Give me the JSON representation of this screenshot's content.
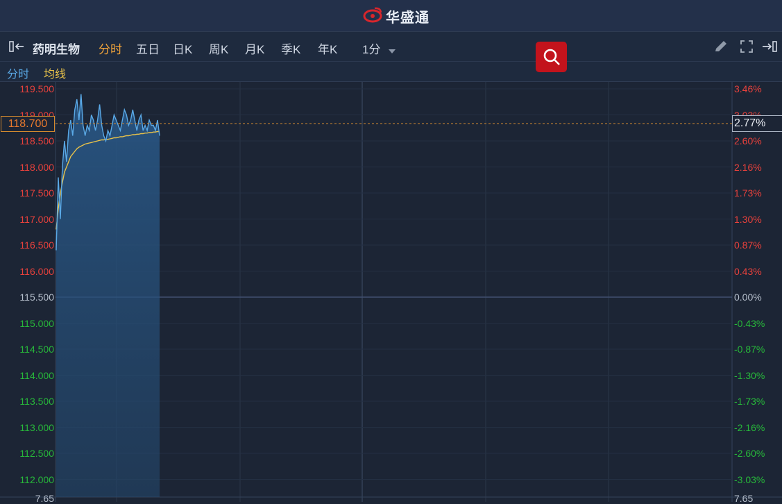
{
  "app": {
    "brand_name": "华盛通"
  },
  "toolbar": {
    "stock_name": "药明生物",
    "tabs": [
      "分时",
      "五日",
      "日K",
      "周K",
      "月K",
      "季K",
      "年K"
    ],
    "active_tab": "分时",
    "interval_label": "1分"
  },
  "legend": {
    "line1": "分时",
    "line2": "均线"
  },
  "indicators": {
    "current_price": "118.700",
    "current_pct": "2.77%"
  },
  "axis": {
    "left_labels": [
      "119.500",
      "119.000",
      "118.500",
      "118.000",
      "117.500",
      "117.000",
      "116.500",
      "116.000",
      "115.500",
      "115.000",
      "114.500",
      "114.000",
      "113.500",
      "113.000",
      "112.500",
      "112.000"
    ],
    "right_labels": [
      "3.46%",
      "3.03%",
      "2.60%",
      "2.16%",
      "1.73%",
      "1.30%",
      "0.87%",
      "0.43%",
      "0.00%",
      "-0.43%",
      "-0.87%",
      "-1.30%",
      "-1.73%",
      "-2.16%",
      "-2.60%",
      "-3.03%"
    ],
    "bottom_left_label": "7.65",
    "bottom_right_label": "7.65"
  },
  "colors": {
    "price_line": "#5aa9e6",
    "avg_line": "#e8c24a",
    "up": "#e8413c",
    "down": "#27b83a",
    "accent": "#f0a33a"
  },
  "chart_data": {
    "type": "line",
    "ylim": [
      112.0,
      119.5
    ],
    "base_price": 115.5,
    "series": [
      {
        "name": "分时",
        "values": [
          116.4,
          117.8,
          117.0,
          118.0,
          118.5,
          118.1,
          118.7,
          118.9,
          118.6,
          119.1,
          119.3,
          118.9,
          119.4,
          118.8,
          118.6,
          118.8,
          118.7,
          119.0,
          118.9,
          118.7,
          118.9,
          119.2,
          118.8,
          118.6,
          118.5,
          118.7,
          118.6,
          118.8,
          119.0,
          118.9,
          118.8,
          118.7,
          118.9,
          119.1,
          119.0,
          118.8,
          118.9,
          119.1,
          118.9,
          118.7,
          118.9,
          119.0,
          118.7,
          118.8,
          118.7,
          118.9,
          118.8,
          118.8,
          118.7,
          118.9,
          118.6
        ]
      },
      {
        "name": "均线",
        "values": [
          116.8,
          117.2,
          117.5,
          117.7,
          117.9,
          118.0,
          118.1,
          118.2,
          118.25,
          118.3,
          118.35,
          118.38,
          118.4,
          118.42,
          118.44,
          118.45,
          118.46,
          118.47,
          118.48,
          118.49,
          118.5,
          118.51,
          118.52,
          118.52,
          118.53,
          118.53,
          118.54,
          118.55,
          118.56,
          118.56,
          118.57,
          118.58,
          118.58,
          118.59,
          118.6,
          118.6,
          118.61,
          118.62,
          118.62,
          118.63,
          118.63,
          118.64,
          118.64,
          118.65,
          118.65,
          118.66,
          118.66,
          118.67,
          118.67,
          118.68,
          118.68
        ]
      }
    ]
  }
}
